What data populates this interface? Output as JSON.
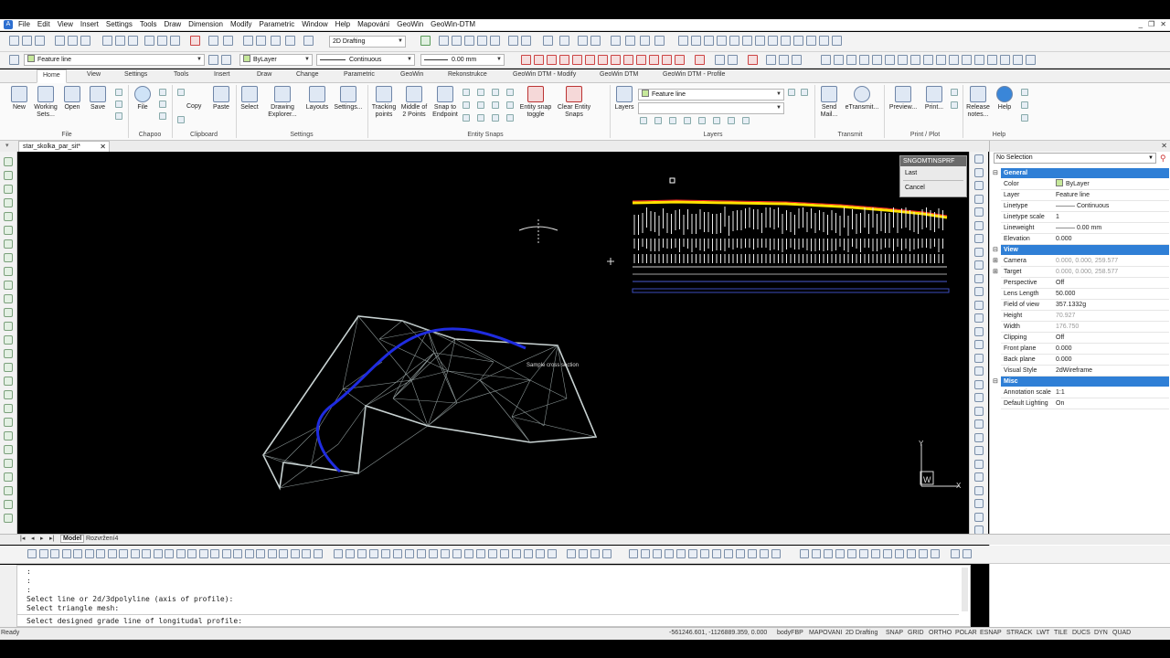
{
  "menu": [
    "File",
    "Edit",
    "View",
    "Insert",
    "Settings",
    "Tools",
    "Draw",
    "Dimension",
    "Modify",
    "Parametric",
    "Window",
    "Help",
    "Mapování",
    "GeoWin",
    "GeoWin-DTM"
  ],
  "toolbar1": {
    "workspace": "2D Drafting"
  },
  "toolbar2": {
    "layer": "Feature line",
    "color": "ByLayer",
    "linetype": "Continuous",
    "lineweight": "0.00 mm"
  },
  "ribbon_tabs": [
    "Home",
    "View",
    "Settings",
    "Tools",
    "Insert",
    "Draw",
    "Change",
    "Parametric",
    "GeoWin",
    "Rekonstrukce",
    "GeoWin DTM - Modify",
    "GeoWin DTM",
    "GeoWin DTM - Profile"
  ],
  "ribbon": {
    "file": {
      "new": "New",
      "working_sets": "Working Sets...",
      "open": "Open",
      "save": "Save",
      "group": "File"
    },
    "chapoo": {
      "file": "File",
      "group": "Chapoo"
    },
    "clipboard": {
      "copy": "Copy",
      "paste": "Paste",
      "group": "Clipboard"
    },
    "settings": {
      "select": "Select",
      "drawing_explorer": "Drawing Explorer...",
      "layouts": "Layouts",
      "settings": "Settings...",
      "group": "Settings"
    },
    "snaps": {
      "tracking_points": "Tracking points",
      "middle_2pts": "Middle of 2 Points",
      "snap_endpoint": "Snap to Endpoint",
      "entity_snap_toggle": "Entity snap toggle",
      "clear_snaps": "Clear Entity Snaps",
      "group": "Entity Snaps"
    },
    "layers": {
      "layers": "Layers",
      "current": "Feature line",
      "group": "Layers"
    },
    "transmit": {
      "send_mail": "Send Mail...",
      "etransmit": "eTransmit...",
      "group": "Transmit"
    },
    "print": {
      "preview": "Preview...",
      "print": "Print...",
      "group": "Print / Plot"
    },
    "help": {
      "release_notes": "Release notes...",
      "help": "Help",
      "group": "Help"
    }
  },
  "doc_tab": "star_skolka_par_sit*",
  "canvas": {
    "section_label": "Sample cross section",
    "ucs_w": "W",
    "ucs_x": "X",
    "ucs_y": "Y"
  },
  "osnap_menu": {
    "title": "SNGOMTINSPRF",
    "items": [
      "Last",
      "Cancel"
    ]
  },
  "properties": {
    "selection": "No Selection",
    "general": {
      "title": "General",
      "rows": [
        {
          "k": "Color",
          "v": "ByLayer"
        },
        {
          "k": "Layer",
          "v": "Feature line"
        },
        {
          "k": "Linetype",
          "v": "——— Continuous"
        },
        {
          "k": "Linetype scale",
          "v": "1"
        },
        {
          "k": "Lineweight",
          "v": "——— 0.00 mm"
        },
        {
          "k": "Elevation",
          "v": "0.000"
        }
      ]
    },
    "view": {
      "title": "View",
      "rows": [
        {
          "k": "Camera",
          "v": "0.000, 0.000, 259.577"
        },
        {
          "k": "Target",
          "v": "0.000, 0.000, 258.577"
        },
        {
          "k": "Perspective",
          "v": "Off"
        },
        {
          "k": "Lens Length",
          "v": "50.000"
        },
        {
          "k": "Field of view",
          "v": "357.1332g"
        },
        {
          "k": "Height",
          "v": "70.927"
        },
        {
          "k": "Width",
          "v": "176.750"
        },
        {
          "k": "Clipping",
          "v": "Off"
        },
        {
          "k": "Front plane",
          "v": "0.000"
        },
        {
          "k": "Back plane",
          "v": "0.000"
        },
        {
          "k": "Visual Style",
          "v": "2dWireframe"
        }
      ]
    },
    "misc": {
      "title": "Misc",
      "rows": [
        {
          "k": "Annotation scale",
          "v": "1:1"
        },
        {
          "k": "Default Lighting",
          "v": "On"
        }
      ]
    }
  },
  "layout_tabs": [
    "Model",
    "Rozvržení4"
  ],
  "command": {
    "lines": [
      ":",
      ":",
      ":",
      "Select line or 2d/3dpolyline (axis of profile):",
      "Select triangle mesh:"
    ],
    "prompt": "Select designed grade line of longitudal profile:"
  },
  "status": {
    "ready": "Ready",
    "coords": "-561246.601, -1126889.359, 0.000",
    "items": [
      "bodyFBP",
      "MAPOVANI",
      "2D Drafting",
      "SNAP",
      "GRID",
      "ORTHO",
      "POLAR",
      "ESNAP",
      "STRACK",
      "LWT",
      "TILE",
      "DUCS",
      "DYN",
      "QUAD"
    ]
  }
}
